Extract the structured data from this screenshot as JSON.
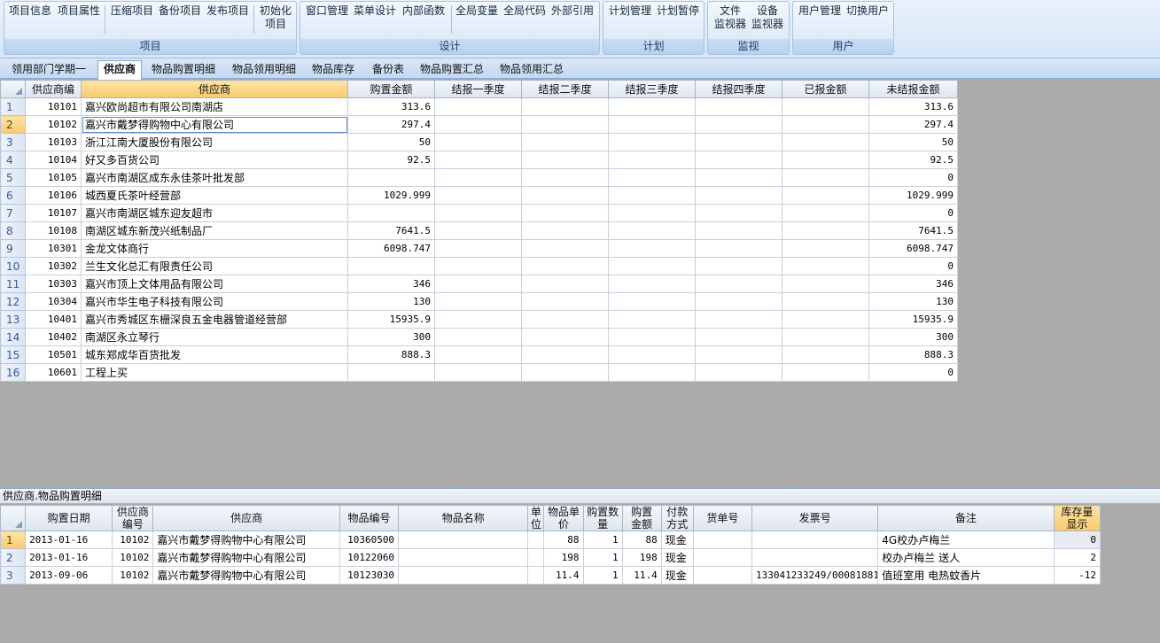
{
  "ribbon": {
    "groups": [
      {
        "title": "项目",
        "buttons": [
          "项目信息",
          "项目属性",
          "压缩项目",
          "备份项目",
          "发布项目",
          "初始化\n项目"
        ]
      },
      {
        "title": "设计",
        "buttons": [
          "窗口管理",
          "菜单设计",
          "内部函数",
          "全局变量",
          "全局代码",
          "外部引用"
        ]
      },
      {
        "title": "计划",
        "buttons": [
          "计划管理",
          "计划暂停"
        ]
      },
      {
        "title": "监视",
        "buttons": [
          "文件\n监视器",
          "设备\n监视器"
        ]
      },
      {
        "title": "用户",
        "buttons": [
          "用户管理",
          "切换用户"
        ]
      }
    ]
  },
  "tabs": [
    "领用部门学期一",
    "供应商",
    "物品购置明细",
    "物品领用明细",
    "物品库存",
    "备份表",
    "物品购置汇总",
    "物品领用汇总"
  ],
  "active_tab": 1,
  "supplier_grid": {
    "columns": [
      "供应商编",
      "供应商",
      "购置金额",
      "结报一季度",
      "结报二季度",
      "结报三季度",
      "结报四季度",
      "已报金额",
      "未结报金额"
    ],
    "rows": [
      [
        "1",
        "10101",
        "嘉兴欧尚超市有限公司南湖店",
        "313.6",
        "",
        "",
        "",
        "",
        "",
        "313.6"
      ],
      [
        "2",
        "10102",
        "嘉兴市戴梦得购物中心有限公司",
        "297.4",
        "",
        "",
        "",
        "",
        "",
        "297.4"
      ],
      [
        "3",
        "10103",
        "浙江江南大厦股份有限公司",
        "50",
        "",
        "",
        "",
        "",
        "",
        "50"
      ],
      [
        "4",
        "10104",
        "好又多百货公司",
        "92.5",
        "",
        "",
        "",
        "",
        "",
        "92.5"
      ],
      [
        "5",
        "10105",
        "嘉兴市南湖区成东永佳茶叶批发部",
        "",
        "",
        "",
        "",
        "",
        "",
        "0"
      ],
      [
        "6",
        "10106",
        "城西夏氏茶叶经营部",
        "1029.999",
        "",
        "",
        "",
        "",
        "",
        "1029.999"
      ],
      [
        "7",
        "10107",
        "嘉兴市南湖区城东迎友超市",
        "",
        "",
        "",
        "",
        "",
        "",
        "0"
      ],
      [
        "8",
        "10108",
        "南湖区城东新茂兴纸制品厂",
        "7641.5",
        "",
        "",
        "",
        "",
        "",
        "7641.5"
      ],
      [
        "9",
        "10301",
        "金龙文体商行",
        "6098.747",
        "",
        "",
        "",
        "",
        "",
        "6098.747"
      ],
      [
        "10",
        "10302",
        "兰生文化总汇有限责任公司",
        "",
        "",
        "",
        "",
        "",
        "",
        "0"
      ],
      [
        "11",
        "10303",
        "嘉兴市顶上文体用品有限公司",
        "346",
        "",
        "",
        "",
        "",
        "",
        "346"
      ],
      [
        "12",
        "10304",
        "嘉兴市华生电子科技有限公司",
        "130",
        "",
        "",
        "",
        "",
        "",
        "130"
      ],
      [
        "13",
        "10401",
        "嘉兴市秀城区东栅深良五金电器管道经营部",
        "15935.9",
        "",
        "",
        "",
        "",
        "",
        "15935.9"
      ],
      [
        "14",
        "10402",
        "南湖区永立琴行",
        "300",
        "",
        "",
        "",
        "",
        "",
        "300"
      ],
      [
        "15",
        "10501",
        "城东郑成华百货批发",
        "888.3",
        "",
        "",
        "",
        "",
        "",
        "888.3"
      ],
      [
        "16",
        "10601",
        "工程上买",
        "",
        "",
        "",
        "",
        "",
        "",
        "0"
      ]
    ]
  },
  "detail_panel": {
    "title": "供应商.物品购置明细",
    "columns": [
      "购置日期",
      "供应商\n编号",
      "供应商",
      "物品编号",
      "物品名称",
      "单\n位",
      "物品单\n价",
      "购置数\n量",
      "购置\n金额",
      "付款\n方式",
      "货单号",
      "发票号",
      "备注",
      "库存量\n显示"
    ],
    "rows": [
      [
        "1",
        "2013-01-16",
        "10102",
        "嘉兴市戴梦得购物中心有限公司",
        "10360500",
        "",
        "",
        "88",
        "1",
        "88",
        "现金",
        "",
        "",
        "4G校办卢梅兰",
        "0"
      ],
      [
        "2",
        "2013-01-16",
        "10102",
        "嘉兴市戴梦得购物中心有限公司",
        "10122060",
        "",
        "",
        "198",
        "1",
        "198",
        "现金",
        "",
        "",
        "校办卢梅兰 送人",
        "2"
      ],
      [
        "3",
        "2013-09-06",
        "10102",
        "嘉兴市戴梦得购物中心有限公司",
        "10123030",
        "",
        "",
        "11.4",
        "1",
        "11.4",
        "现金",
        "",
        "133041233249/00081881",
        "值班室用 电热蚊香片",
        "-12"
      ]
    ]
  }
}
